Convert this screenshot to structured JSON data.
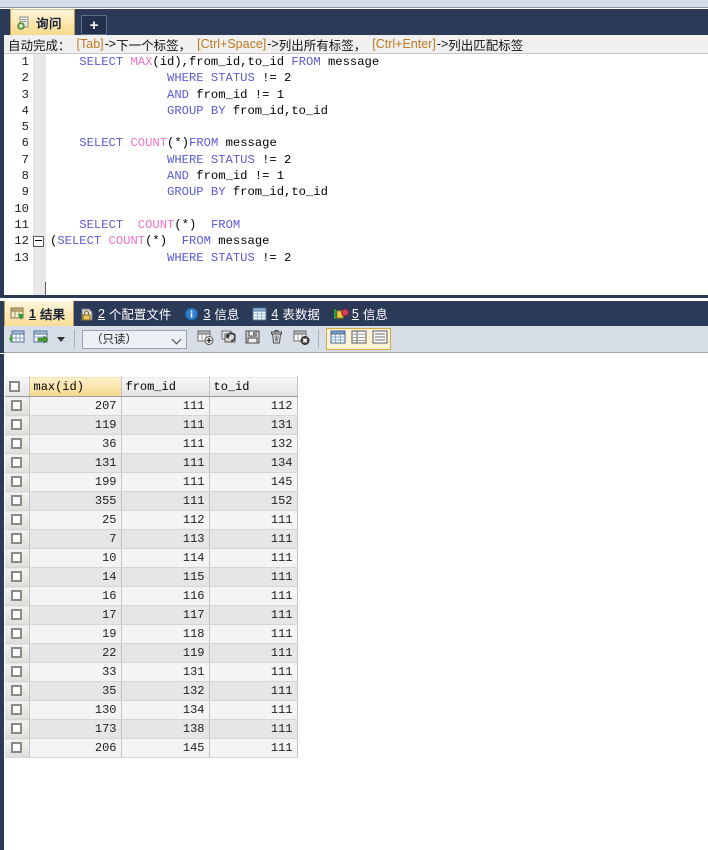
{
  "window": {
    "app": "Navicat-like SQL Query Editor"
  },
  "tabbar": {
    "query_tab_label": "询问",
    "query_tab_icon": "query-document-icon",
    "new_tab_label": "+",
    "new_tab_icon": "plus-icon"
  },
  "hint": {
    "prefix": "自动完成：",
    "items": [
      {
        "key": "[Tab]",
        "arrow": "-> ",
        "text": "下一个标签，"
      },
      {
        "key": "[Ctrl+Space]",
        "arrow": "-> ",
        "text": "列出所有标签，"
      },
      {
        "key": "[Ctrl+Enter]",
        "arrow": "-> ",
        "text": "列出匹配标签"
      }
    ]
  },
  "editor": {
    "lines": [
      {
        "n": "1",
        "fold": false,
        "tokens": [
          {
            "t": "    ",
            "c": "ctext"
          },
          {
            "t": "SELECT ",
            "c": "kw"
          },
          {
            "t": "MAX",
            "c": "fn"
          },
          {
            "t": "(id),from_id,to_id ",
            "c": "ctext"
          },
          {
            "t": "FROM ",
            "c": "kw"
          },
          {
            "t": "message",
            "c": "ctext"
          }
        ]
      },
      {
        "n": "2",
        "fold": false,
        "tokens": [
          {
            "t": "                ",
            "c": "ctext"
          },
          {
            "t": "WHERE STATUS ",
            "c": "kw"
          },
          {
            "t": "!= 2",
            "c": "ctext"
          }
        ]
      },
      {
        "n": "3",
        "fold": false,
        "tokens": [
          {
            "t": "                ",
            "c": "ctext"
          },
          {
            "t": "AND ",
            "c": "kw"
          },
          {
            "t": "from_id != 1",
            "c": "ctext"
          }
        ]
      },
      {
        "n": "4",
        "fold": false,
        "tokens": [
          {
            "t": "                ",
            "c": "ctext"
          },
          {
            "t": "GROUP BY ",
            "c": "kw"
          },
          {
            "t": "from_id,to_id",
            "c": "ctext"
          }
        ]
      },
      {
        "n": "5",
        "fold": false,
        "tokens": []
      },
      {
        "n": "6",
        "fold": false,
        "tokens": [
          {
            "t": "    ",
            "c": "ctext"
          },
          {
            "t": "SELECT ",
            "c": "kw"
          },
          {
            "t": "COUNT",
            "c": "fn"
          },
          {
            "t": "(*)",
            "c": "ctext"
          },
          {
            "t": "FROM ",
            "c": "kw"
          },
          {
            "t": "message",
            "c": "ctext"
          }
        ]
      },
      {
        "n": "7",
        "fold": false,
        "tokens": [
          {
            "t": "                ",
            "c": "ctext"
          },
          {
            "t": "WHERE STATUS ",
            "c": "kw"
          },
          {
            "t": "!= 2",
            "c": "ctext"
          }
        ]
      },
      {
        "n": "8",
        "fold": false,
        "tokens": [
          {
            "t": "                ",
            "c": "ctext"
          },
          {
            "t": "AND ",
            "c": "kw"
          },
          {
            "t": "from_id != 1",
            "c": "ctext"
          }
        ]
      },
      {
        "n": "9",
        "fold": false,
        "tokens": [
          {
            "t": "                ",
            "c": "ctext"
          },
          {
            "t": "GROUP BY ",
            "c": "kw"
          },
          {
            "t": "from_id,to_id",
            "c": "ctext"
          }
        ]
      },
      {
        "n": "10",
        "fold": false,
        "tokens": []
      },
      {
        "n": "11",
        "fold": false,
        "tokens": [
          {
            "t": "    ",
            "c": "ctext"
          },
          {
            "t": "SELECT  ",
            "c": "kw"
          },
          {
            "t": "COUNT",
            "c": "fn"
          },
          {
            "t": "(*)  ",
            "c": "ctext"
          },
          {
            "t": "FROM",
            "c": "kw"
          }
        ]
      },
      {
        "n": "12",
        "fold": true,
        "tokens": [
          {
            "t": "(",
            "c": "ctext"
          },
          {
            "t": "SELECT ",
            "c": "kw"
          },
          {
            "t": "COUNT",
            "c": "fn"
          },
          {
            "t": "(*)  ",
            "c": "ctext"
          },
          {
            "t": "FROM ",
            "c": "kw"
          },
          {
            "t": "message",
            "c": "ctext"
          }
        ]
      },
      {
        "n": "13",
        "fold": false,
        "tokens": [
          {
            "t": "                ",
            "c": "ctext"
          },
          {
            "t": "WHERE STATUS ",
            "c": "kw"
          },
          {
            "t": "!= 2",
            "c": "ctext"
          }
        ]
      }
    ]
  },
  "result_tabs": [
    {
      "num": "1",
      "label": "结果",
      "icon": "result-grid-icon",
      "active": true
    },
    {
      "num": "2",
      "label": "个配置文件",
      "prefix": true,
      "icon": "profile-icon",
      "active": false
    },
    {
      "num": "3",
      "label": "信息",
      "icon": "info-icon",
      "active": false
    },
    {
      "num": "4",
      "label": "表数据",
      "icon": "table-data-icon",
      "active": false
    },
    {
      "num": "5",
      "label": "信息",
      "icon": "message-icon",
      "active": false
    }
  ],
  "grid_toolbar": {
    "mode_value": "（只读）",
    "buttons": [
      {
        "name": "grid-view-button",
        "icon": "grid-icon"
      },
      {
        "name": "form-view-button",
        "icon": "grid-arrow-icon"
      },
      {
        "name": "view-dropdown-caret",
        "icon": "caret-down-icon"
      },
      {
        "name": "add-record-button",
        "icon": "table-plus-icon"
      },
      {
        "name": "refresh-record-button",
        "icon": "refresh-icon"
      },
      {
        "name": "save-record-button",
        "icon": "floppy-icon"
      },
      {
        "name": "delete-record-button",
        "icon": "trash-icon"
      },
      {
        "name": "cancel-record-button",
        "icon": "table-cancel-icon"
      },
      {
        "name": "grid-layout-button",
        "icon": "grid-layout-icon"
      },
      {
        "name": "form-layout-button",
        "icon": "form-layout-icon"
      },
      {
        "name": "list-layout-button",
        "icon": "list-layout-icon"
      }
    ]
  },
  "result_grid": {
    "columns": [
      "max(id)",
      "from_id",
      "to_id"
    ],
    "active_column": "max(id)",
    "rows": [
      [
        "207",
        "111",
        "112"
      ],
      [
        "119",
        "111",
        "131"
      ],
      [
        "36",
        "111",
        "132"
      ],
      [
        "131",
        "111",
        "134"
      ],
      [
        "199",
        "111",
        "145"
      ],
      [
        "355",
        "111",
        "152"
      ],
      [
        "25",
        "112",
        "111"
      ],
      [
        "7",
        "113",
        "111"
      ],
      [
        "10",
        "114",
        "111"
      ],
      [
        "14",
        "115",
        "111"
      ],
      [
        "16",
        "116",
        "111"
      ],
      [
        "17",
        "117",
        "111"
      ],
      [
        "19",
        "118",
        "111"
      ],
      [
        "22",
        "119",
        "111"
      ],
      [
        "33",
        "131",
        "111"
      ],
      [
        "35",
        "132",
        "111"
      ],
      [
        "130",
        "134",
        "111"
      ],
      [
        "173",
        "138",
        "111"
      ],
      [
        "206",
        "145",
        "111"
      ]
    ]
  },
  "colors": {
    "chrome_navy": "#2b3a57",
    "tab_active_gold": "#f8dd94",
    "keyword_blue": "#5b5bd6",
    "function_pink": "#f072c8",
    "hint_highlight": "#c07820"
  }
}
